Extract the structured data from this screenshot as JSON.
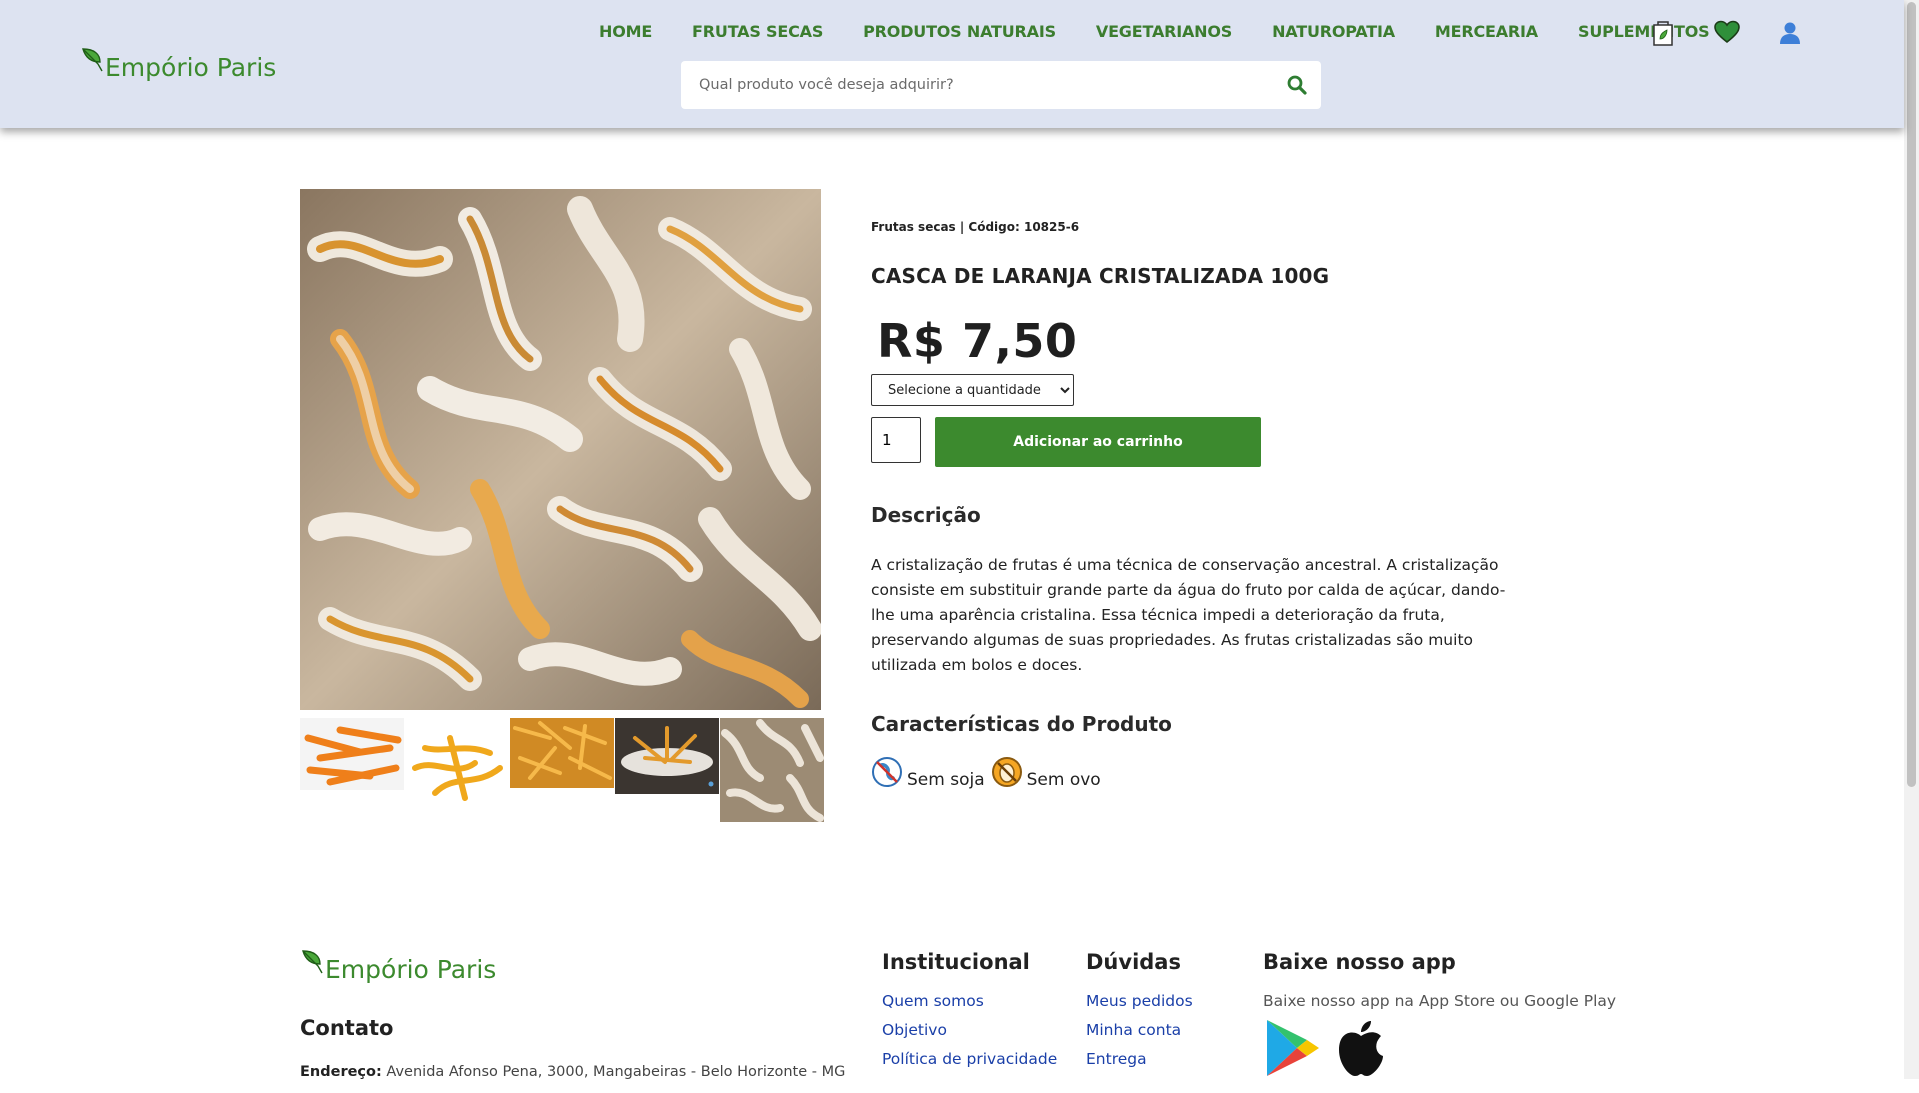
{
  "brand": {
    "name": "Empório Paris"
  },
  "nav": {
    "items": [
      "HOME",
      "FRUTAS SECAS",
      "PRODUTOS NATURAIS",
      "VEGETARIANOS",
      "NATUROPATIA",
      "MERCEARIA",
      "SUPLEMENTOS"
    ],
    "icons": [
      "shopping-bag-icon",
      "heart-icon",
      "user-icon"
    ]
  },
  "search": {
    "placeholder": "Qual produto você deseja adquirir?",
    "value": ""
  },
  "product": {
    "breadcrumb": "Frutas secas | Código: 10825-6",
    "title": "CASCA DE LARANJA CRISTALIZADA 100G",
    "price": "R$ 7,50",
    "select_option": "Selecione a quantidade",
    "quantity": "1",
    "add_to_cart": "Adicionar ao carrinho",
    "description_title": "Descrição",
    "description": "A cristalização de frutas é uma técnica de conservação ancestral. A cristalização consiste em substituir grande parte da água do fruto por calda de açúcar, dando-lhe uma aparência cristalina. Essa técnica impedi a deterioração da fruta, preservando algumas de suas propriedades. As frutas cristalizadas são muito utilizada em bolos e doces.",
    "characteristics_title": "Características do Produto",
    "characteristics": [
      "Sem soja",
      "Sem ovo"
    ]
  },
  "footer": {
    "contact_title": "Contato",
    "address_label": "Endereço:",
    "address": "Avenida Afonso Pena, 3000, Mangabeiras - Belo Horizonte - MG",
    "institucional": {
      "title": "Institucional",
      "links": [
        "Quem somos",
        "Objetivo",
        "Política de privacidade"
      ]
    },
    "duvidas": {
      "title": "Dúvidas",
      "links": [
        "Meus pedidos",
        "Minha conta",
        "Entrega"
      ]
    },
    "app": {
      "title": "Baixe nosso app",
      "text": "Baixe nosso app na App Store ou Google Play"
    }
  },
  "colors": {
    "header_bg": "#dde3f1",
    "brand_green": "#3c8a2e",
    "nav_green": "#3c7d2f",
    "link_blue": "#1a3fa8"
  }
}
